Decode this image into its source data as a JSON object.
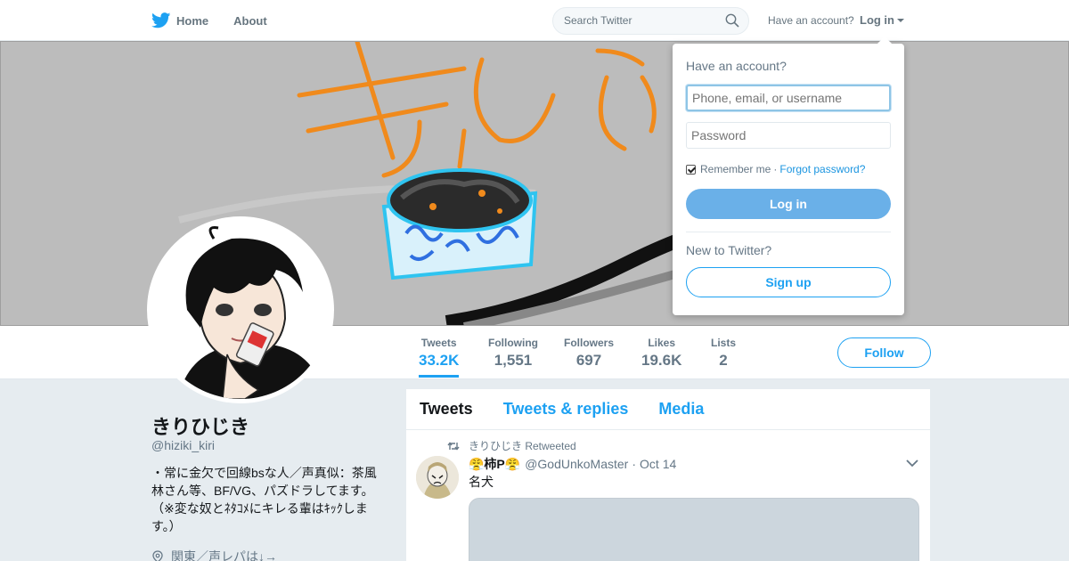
{
  "topbar": {
    "nav": [
      {
        "label": "Home",
        "icon": "twitter-bird-icon"
      },
      {
        "label": "About"
      }
    ],
    "search_placeholder": "Search Twitter",
    "have_account": "Have an account?",
    "login_label": "Log in"
  },
  "login_dropdown": {
    "title": "Have an account?",
    "username_placeholder": "Phone, email, or username",
    "password_placeholder": "Password",
    "remember_label": "Remember me",
    "separator": "·",
    "forgot_label": "Forgot password?",
    "login_button": "Log in",
    "new_prompt": "New to Twitter?",
    "signup_button": "Sign up"
  },
  "profile": {
    "name": "きりひじき",
    "handle": "@hiziki_kiri",
    "bio": "・常に金欠で回線bsな人／声真似：茶風林さん等、BF/VG、パズドラしてます。（※変な奴とﾈﾀｺﾒにキレる輩はｷｯｸします。）",
    "location": "関東／声レパは↓→"
  },
  "stats": [
    {
      "label": "Tweets",
      "value": "33.2K",
      "active": true
    },
    {
      "label": "Following",
      "value": "1,551"
    },
    {
      "label": "Followers",
      "value": "697"
    },
    {
      "label": "Likes",
      "value": "19.6K"
    },
    {
      "label": "Lists",
      "value": "2"
    }
  ],
  "follow_label": "Follow",
  "tabs": [
    {
      "label": "Tweets",
      "active": true
    },
    {
      "label": "Tweets & replies"
    },
    {
      "label": "Media"
    }
  ],
  "tweet": {
    "retweet_label": "きりひじき Retweeted",
    "author_name": "😤柿P😤",
    "author_handle": "@GodUnkoMaster",
    "separator": "·",
    "date": "Oct 14",
    "text": "名犬"
  },
  "colors": {
    "accent": "#1da1f2",
    "login_button": "#6ab0e8",
    "background": "#e6ecf0"
  }
}
